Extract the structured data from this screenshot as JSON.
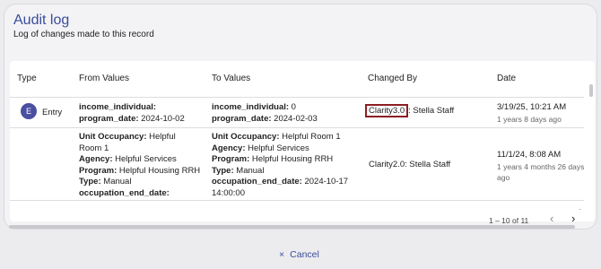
{
  "header": {
    "title": "Audit log",
    "subtitle": "Log of changes made to this record"
  },
  "table": {
    "columns": [
      "Type",
      "From Values",
      "To Values",
      "Changed By",
      "Date"
    ],
    "rows": [
      {
        "avatar": "E",
        "type": "Entry",
        "from": [
          {
            "k": "income_individual:",
            "v": ""
          },
          {
            "k": "program_date:",
            "v": " 2024-10-02"
          }
        ],
        "to": [
          {
            "k": "income_individual:",
            "v": " 0"
          },
          {
            "k": "program_date:",
            "v": " 2024-02-03"
          }
        ],
        "changed_by_prefix": "Clarity3.0",
        "changed_by_rest": ": Stella Staff",
        "date": "3/19/25, 10:21 AM",
        "ago": "1 years 8 days ago"
      },
      {
        "from_lines": [
          "Unit Occupancy: Helpful",
          "Room 1",
          "Agency: Helpful Services",
          "Program: Helpful Housing RRH",
          "Type: Manual",
          "occupation_end_date:"
        ],
        "to_lines": [
          "Unit Occupancy: Helpful Room 1",
          "Agency: Helpful Services",
          "Program: Helpful Housing RRH",
          "Type: Manual",
          "occupation_end_date: 2024-10-17",
          "14:00:00"
        ],
        "changed_by": "Clarity2.0: Stella Staff",
        "date": "11/1/24, 8:08 AM",
        "ago": "1 years 4 months 26 days ago"
      }
    ]
  },
  "pagination": {
    "range": "1 – 10 of 11",
    "prev_icon": "‹",
    "next_icon": "›"
  },
  "footer": {
    "cancel_icon": "×",
    "cancel_label": "Cancel"
  }
}
